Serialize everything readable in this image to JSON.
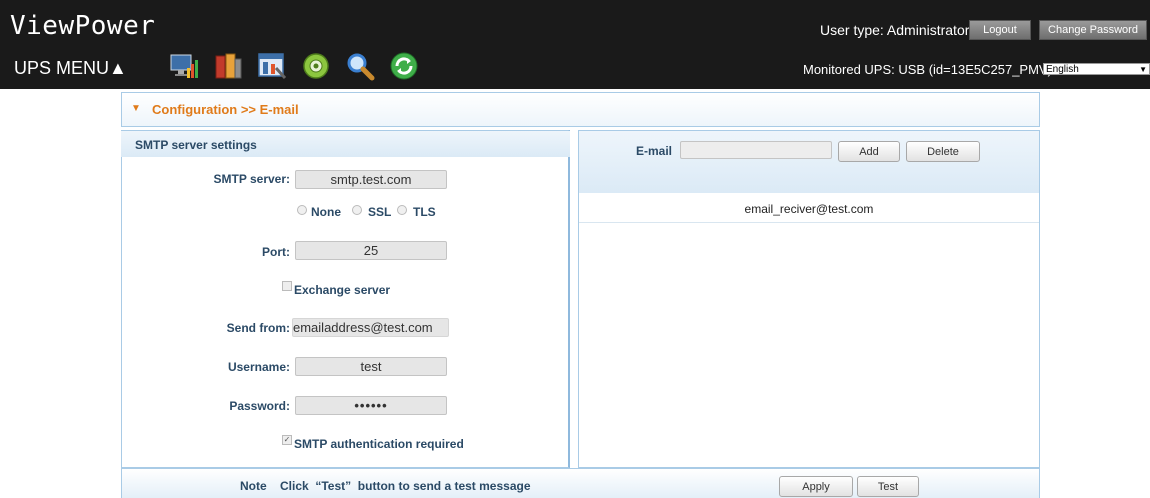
{
  "header": {
    "app_title": "ViewPower",
    "ups_menu": "UPS MENU▲",
    "user_type": "User type: Administrator",
    "logout_label": "Logout",
    "change_password_label": "Change Password",
    "monitored_ups": "Monitored UPS: USB (id=13E5C257_PMV)",
    "language": "English",
    "toolbar_icons": [
      "monitor-chart-icon",
      "ups-devices-icon",
      "tools-config-icon",
      "gear-ring-icon",
      "magnifier-icon",
      "refresh-icon"
    ]
  },
  "breadcrumb": {
    "text": "Configuration >> E-mail"
  },
  "smtp": {
    "section_title": "SMTP server settings",
    "server_label": "SMTP server:",
    "server_value": "smtp.test.com",
    "security_options": [
      "None",
      "SSL",
      "TLS"
    ],
    "port_label": "Port:",
    "port_value": "25",
    "exchange_label": "Exchange server",
    "send_from_label": "Send from:",
    "send_from_value": "emailaddress@test.com",
    "username_label": "Username:",
    "username_value": "test",
    "password_label": "Password:",
    "password_value": "••••••",
    "auth_label": "SMTP authentication required",
    "auth_checked": true
  },
  "recipients": {
    "email_label": "E-mail",
    "add_label": "Add",
    "delete_label": "Delete",
    "list": [
      "email_reciver@test.com"
    ]
  },
  "footer": {
    "note": "Note    Click  “Test”  button to send a test message",
    "apply_label": "Apply",
    "test_label": "Test"
  },
  "colors": {
    "header_bg": "#1a1a1a",
    "accent_orange": "#e07b1a",
    "label_blue": "#2b4a66",
    "panel_border": "#a9cbe6"
  }
}
